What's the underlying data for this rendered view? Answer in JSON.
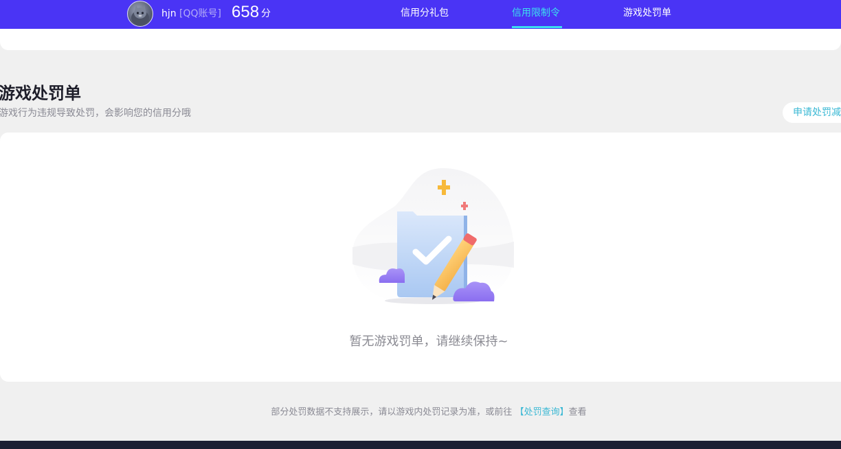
{
  "header": {
    "username": "hjn",
    "account_type": "[QQ账号]",
    "score": "658",
    "score_unit": "分",
    "nav": [
      {
        "label": "信用分礼包",
        "active": false
      },
      {
        "label": "信用限制令",
        "active": true
      },
      {
        "label": "游戏处罚单",
        "active": false
      }
    ]
  },
  "section": {
    "title": "游戏处罚单",
    "description": "游戏行为违规导致处罚，会影响您的信用分哦",
    "appeal_button": "申请处罚减"
  },
  "empty_state": {
    "message": "暂无游戏罚单，请继续保持~"
  },
  "note": {
    "prefix": "部分处罚数据不支持展示，请以游戏内处罚记录为准，或前往",
    "link": "【处罚查询】",
    "suffix": "查看"
  },
  "colors": {
    "header_bg": "#4a34f5",
    "nav_active": "#3ce0ee",
    "link": "#3ab8d4",
    "page_bg": "#f0f0f0",
    "footer_bg": "#1c1e33"
  }
}
